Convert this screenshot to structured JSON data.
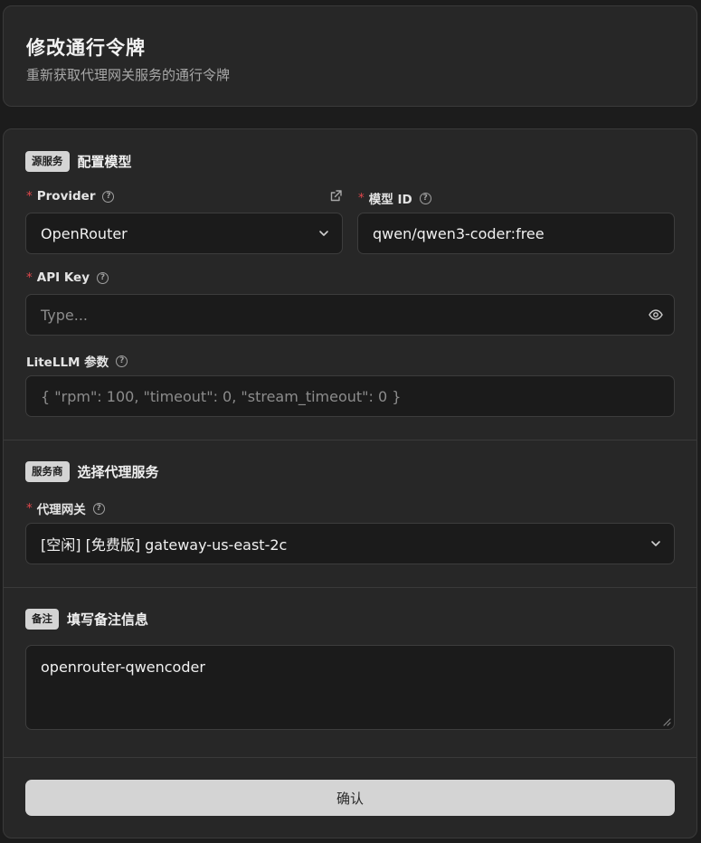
{
  "header": {
    "title": "修改通行令牌",
    "subtitle": "重新获取代理网关服务的通行令牌"
  },
  "source": {
    "badge": "源服务",
    "title": "配置模型",
    "provider": {
      "label": "Provider",
      "value": "OpenRouter"
    },
    "model_id": {
      "label": "模型 ID",
      "value": "qwen/qwen3-coder:free"
    },
    "api_key": {
      "label": "API Key",
      "placeholder": "Type..."
    },
    "litellm": {
      "label": "LiteLLM 参数",
      "placeholder": "{ \"rpm\": 100, \"timeout\": 0, \"stream_timeout\": 0 }"
    }
  },
  "proxy": {
    "badge": "服务商",
    "title": "选择代理服务",
    "gateway": {
      "label": "代理网关",
      "value": "[空闲] [免费版] gateway-us-east-2c"
    }
  },
  "note": {
    "badge": "备注",
    "title": "填写备注信息",
    "value": "openrouter-qwencoder"
  },
  "actions": {
    "confirm_label": "确认"
  },
  "required_mark": "*",
  "help_mark": "?",
  "colors": {
    "required": "#e0474c",
    "button_bg": "#d4d4d4",
    "panel_bg": "#272727",
    "input_bg": "#1b1b1b"
  }
}
